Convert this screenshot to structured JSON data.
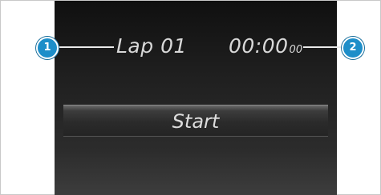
{
  "screen": {
    "lap_label": "Lap 01",
    "time_main": "00:00",
    "time_hundredths": "00",
    "start_button_label": "Start"
  },
  "callouts": [
    {
      "number": "1"
    },
    {
      "number": "2"
    }
  ],
  "colors": {
    "callout_fill": "#1d8ec9",
    "screen_bg": "#1a1a1a",
    "text": "#d8d8d8"
  }
}
